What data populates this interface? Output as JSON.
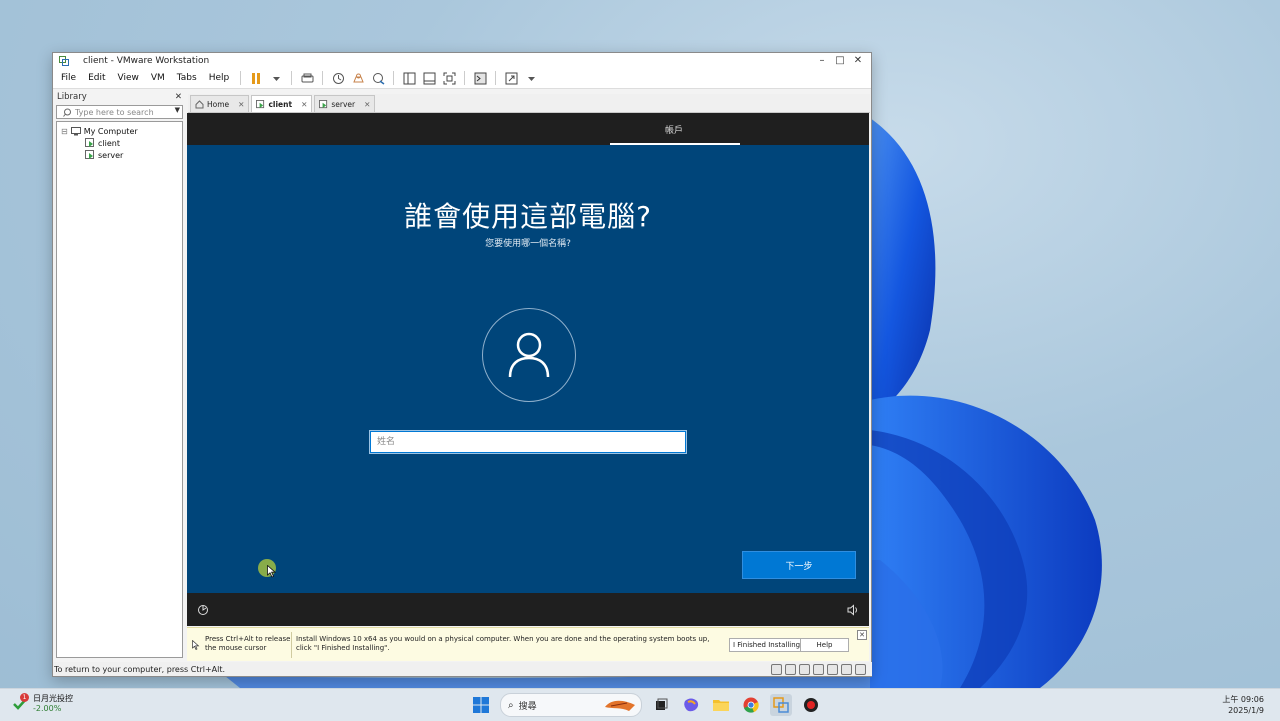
{
  "window": {
    "title": "client - VMware Workstation",
    "controls": {
      "minimize": "–",
      "maximize": "□",
      "close": "✕"
    }
  },
  "menu": [
    "File",
    "Edit",
    "View",
    "VM",
    "Tabs",
    "Help"
  ],
  "toolbar_icons": [
    "pause-icon",
    "dropdown-icon",
    "send-ctrl-alt-del-icon",
    "snapshot-icon",
    "revert-snapshot-icon",
    "snapshot-manager-icon",
    "show-library-icon",
    "thumbnail-bar-icon",
    "full-screen-icon",
    "console-view-icon",
    "stretch-icon"
  ],
  "library": {
    "title": "Library",
    "close": "✕",
    "search_placeholder": "Type here to search",
    "tree": {
      "root": "My Computer",
      "collapse": "⊟",
      "vms": [
        "client",
        "server"
      ]
    }
  },
  "tabs": [
    {
      "label": "Home",
      "close": "✕"
    },
    {
      "label": "client",
      "close": "✕"
    },
    {
      "label": "server",
      "close": "✕"
    }
  ],
  "vm": {
    "step_label": "帳戶",
    "heading": "誰會使用這部電腦?",
    "subheading": "您要使用哪一個名稱?",
    "name_placeholder": "姓名",
    "next_button": "下一步"
  },
  "hint": {
    "release": "Press Ctrl+Alt to release the mouse cursor",
    "message": "Install Windows 10 x64 as you would on a physical computer. When you are done and the operating system boots up, click \"I Finished Installing\".",
    "finished_button": "I Finished Installing",
    "help_button": "Help",
    "close": "✕"
  },
  "status_text": "To return to your computer, press Ctrl+Alt.",
  "taskbar": {
    "weather_badge": "1",
    "weather_name": "日月光投控",
    "weather_change": "-2.00%",
    "search_label": "搜尋",
    "time": "上午 09:06",
    "date": "2025/1/9"
  },
  "colors": {
    "oobe_background": "#00457a",
    "accent_button": "#0078d4",
    "vm_bar": "#1f1f1f"
  }
}
